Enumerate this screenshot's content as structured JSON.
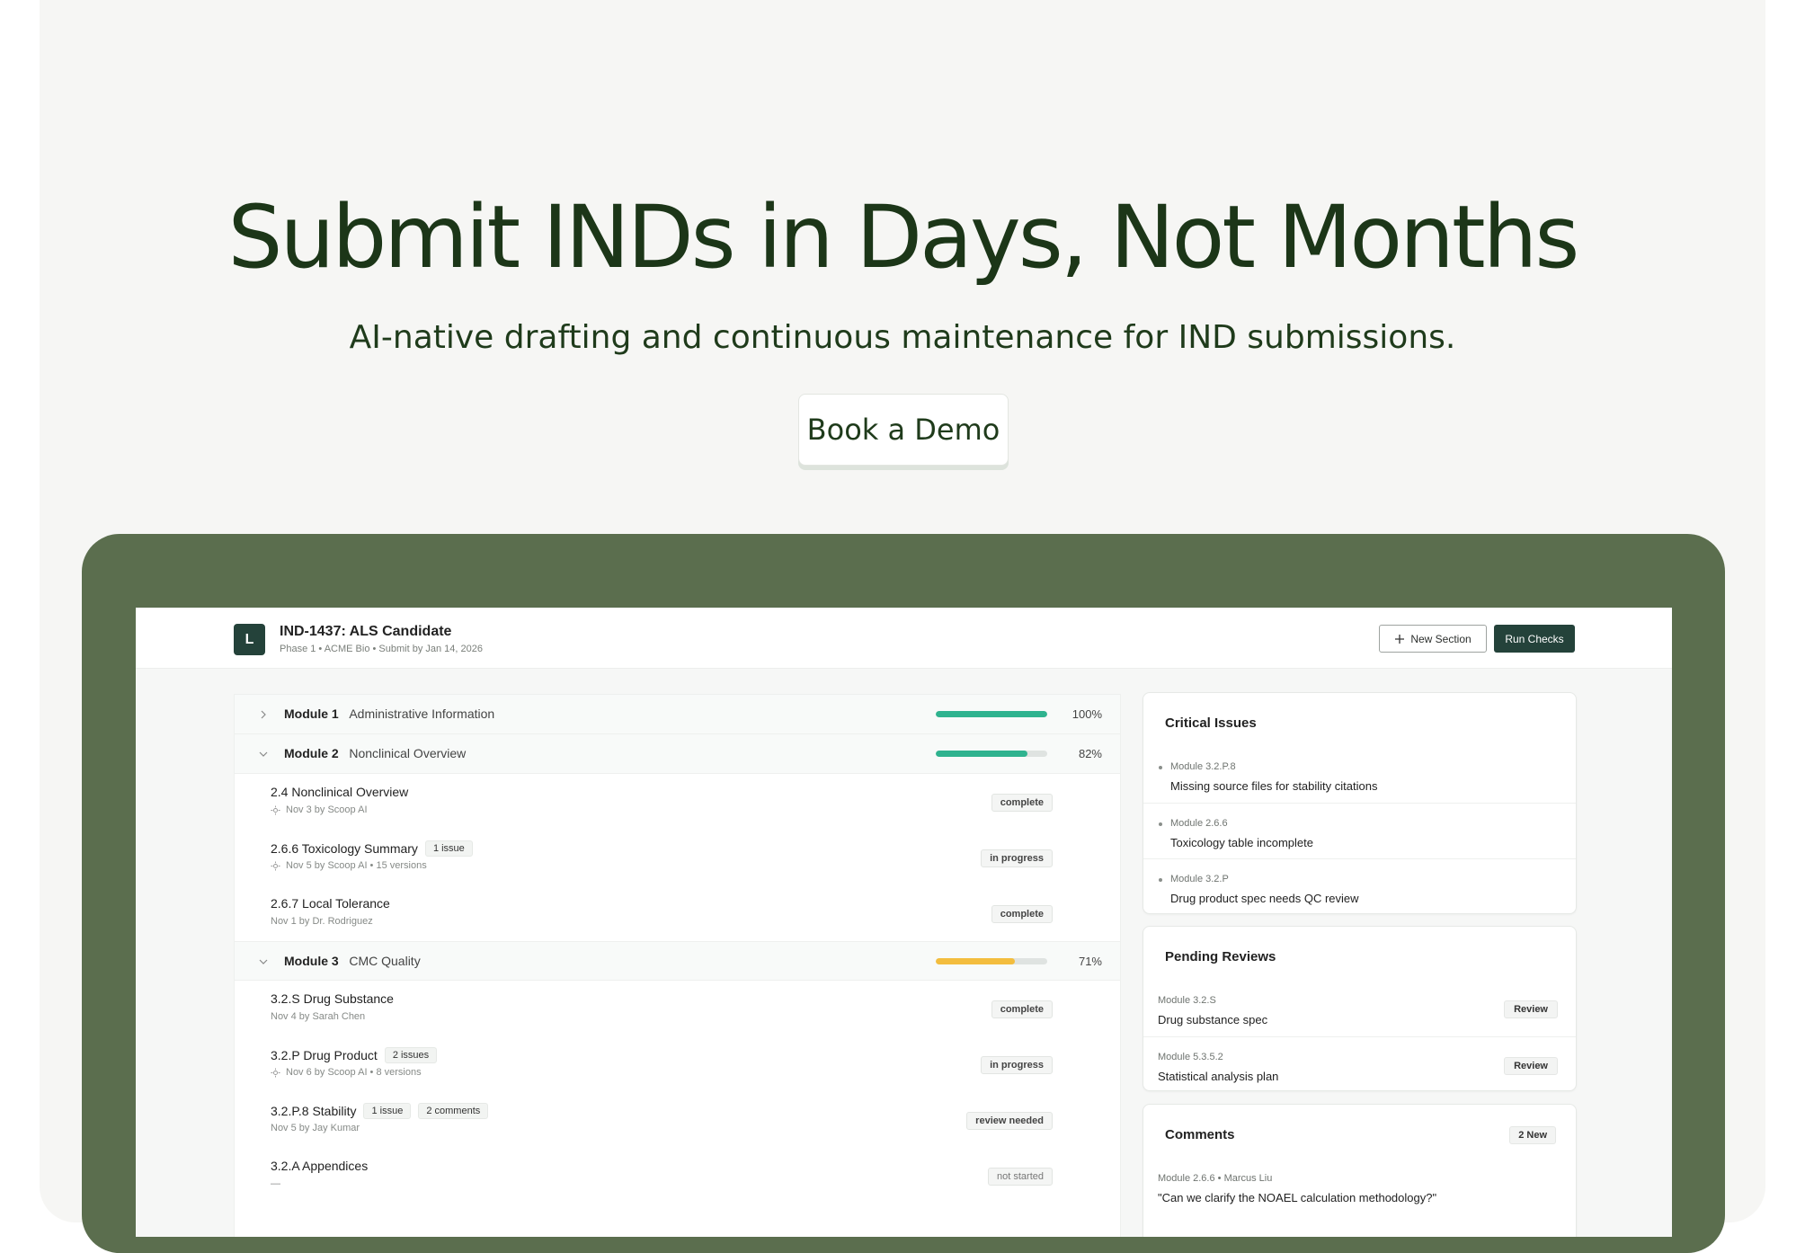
{
  "hero": {
    "title": "Submit INDs in Days, Not Months",
    "subtitle": "AI-native drafting and continuous maintenance for IND submissions.",
    "cta_label": "Book a Demo"
  },
  "app": {
    "logo_letter": "L",
    "project_title": "IND-1437: ALS Candidate",
    "project_meta": "Phase 1 • ACME Bio • Submit by Jan 14, 2026",
    "new_section_label": "New Section",
    "run_checks_label": "Run Checks",
    "colors": {
      "accent_dark": "#24423a",
      "progress_green": "#2fb38f",
      "progress_amber": "#f3bd3e"
    }
  },
  "modules": [
    {
      "name": "Module 1",
      "desc": "Administrative Information",
      "progress": 100,
      "pct_label": "100%",
      "expanded": false
    },
    {
      "name": "Module 2",
      "desc": "Nonclinical Overview",
      "progress": 82,
      "pct_label": "82%",
      "expanded": true
    },
    {
      "name": "Module 3",
      "desc": "CMC Quality",
      "progress": 71,
      "pct_label": "71%",
      "expanded": true
    }
  ],
  "sections": {
    "m2": [
      {
        "title": "2.4 Nonclinical Overview",
        "meta": "Nov 3 by Scoop AI",
        "ai": true,
        "tags": [],
        "status": "complete"
      },
      {
        "title": "2.6.6 Toxicology Summary",
        "meta": "Nov 5 by Scoop AI • 15 versions",
        "ai": true,
        "tags": [
          "1 issue"
        ],
        "status": "in progress"
      },
      {
        "title": "2.6.7 Local Tolerance",
        "meta": "Nov 1 by Dr. Rodriguez",
        "ai": false,
        "tags": [],
        "status": "complete"
      }
    ],
    "m3": [
      {
        "title": "3.2.S Drug Substance",
        "meta": "Nov 4 by Sarah Chen",
        "ai": false,
        "tags": [],
        "status": "complete"
      },
      {
        "title": "3.2.P Drug Product",
        "meta": "Nov 6 by Scoop AI • 8 versions",
        "ai": true,
        "tags": [
          "2 issues"
        ],
        "status": "in progress"
      },
      {
        "title": "3.2.P.8 Stability",
        "meta": "Nov 5 by Jay Kumar",
        "ai": false,
        "tags": [
          "1 issue",
          "2 comments"
        ],
        "status": "review needed"
      },
      {
        "title": "3.2.A Appendices",
        "meta": "—",
        "ai": false,
        "tags": [],
        "status": "not started"
      }
    ]
  },
  "critical": {
    "title": "Critical Issues",
    "items": [
      {
        "module": "Module 3.2.P.8",
        "text": "Missing source files for stability citations"
      },
      {
        "module": "Module 2.6.6",
        "text": "Toxicology table incomplete"
      },
      {
        "module": "Module 3.2.P",
        "text": "Drug product spec needs QC review"
      }
    ]
  },
  "pending": {
    "title": "Pending Reviews",
    "review_label": "Review",
    "items": [
      {
        "module": "Module 3.2.S",
        "text": "Drug substance spec"
      },
      {
        "module": "Module 5.3.5.2",
        "text": "Statistical analysis plan"
      }
    ]
  },
  "comments": {
    "title": "Comments",
    "badge": "2 New",
    "items": [
      {
        "module": "Module 2.6.6 • Marcus Liu",
        "text": "\"Can we clarify the NOAEL calculation methodology?\""
      }
    ]
  }
}
